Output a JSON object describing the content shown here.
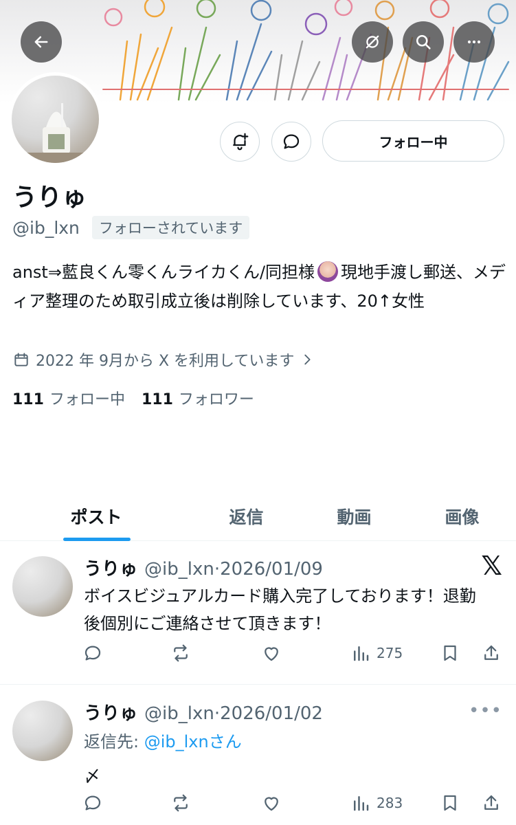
{
  "profile": {
    "name": "うりゅ",
    "handle": "@ib_lxn",
    "follows_you": "フォローされています",
    "follow_button": "フォロー中",
    "bio_part1": "anst⇒藍良くん零くんライカくん/同担様",
    "bio_part2": "現地手渡し郵送、メディア整理のため取引成立後は削除しています、20↑女性",
    "joined": "2022 年 9月から X を利用しています",
    "following_count": "111",
    "following_label": "フォロー中",
    "followers_count": "111",
    "followers_label": "フォロワー"
  },
  "tabs": [
    "ポスト",
    "返信",
    "動画",
    "画像"
  ],
  "posts": [
    {
      "name": "うりゅ",
      "handle": "@ib_lxn",
      "date": "2026/01/09",
      "text": "ボイスビジュアルカード購入完了しております！退勤後個別にご連絡させて頂きます！",
      "views": "275",
      "badge": "𝕏"
    },
    {
      "name": "うりゅ",
      "handle": "@ib_lxn",
      "date": "2026/01/02",
      "reply_prefix": "返信先: ",
      "reply_mention": "@ib_lxnさん",
      "text": "〆",
      "views": "283",
      "more": "•••"
    }
  ],
  "icons": {
    "back": "back-arrow-icon",
    "grok": "grok-icon",
    "search": "search-icon",
    "more": "more-icon",
    "notify": "bell-plus-icon",
    "message": "message-icon",
    "calendar": "calendar-icon",
    "chevron": "chevron-right-icon",
    "reply": "reply-icon",
    "repost": "repost-icon",
    "like": "heart-icon",
    "views": "views-icon",
    "bookmark": "bookmark-icon",
    "share": "share-icon"
  },
  "colors": {
    "accent": "#1d9bf0",
    "text": "#0f1419",
    "secondary": "#536471",
    "border": "#cfd9de"
  }
}
